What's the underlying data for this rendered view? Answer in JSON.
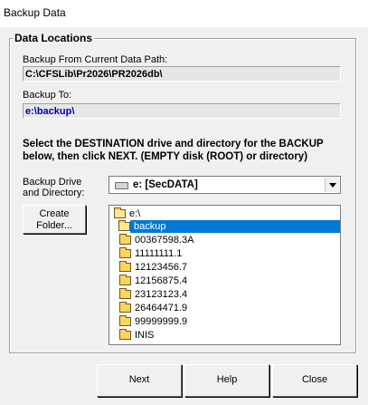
{
  "window": {
    "title": "Backup Data"
  },
  "group": {
    "title": "Data Locations"
  },
  "source": {
    "label": "Backup From Current Data Path:",
    "value": "C:\\CFSLib\\Pr2026\\PR2026db\\"
  },
  "dest": {
    "label": "Backup To:",
    "value": "e:\\backup\\"
  },
  "instructions": {
    "line1": "Select the DESTINATION drive and directory for the BACKUP",
    "line2": "below, then click NEXT. (EMPTY disk (ROOT) or directory)"
  },
  "drive": {
    "label_line1": "Backup Drive",
    "label_line2": "and Directory:",
    "selected": "e: [SecDATA]"
  },
  "create_folder": {
    "line1": "Create",
    "line2": "Folder..."
  },
  "directories": [
    {
      "name": "e:\\",
      "open": true,
      "selected": false
    },
    {
      "name": "backup",
      "open": true,
      "selected": true
    },
    {
      "name": "00367598.3A",
      "open": false,
      "selected": false
    },
    {
      "name": "11111111.1",
      "open": false,
      "selected": false
    },
    {
      "name": "12123456.7",
      "open": false,
      "selected": false
    },
    {
      "name": "12156875.4",
      "open": false,
      "selected": false
    },
    {
      "name": "23123123.4",
      "open": false,
      "selected": false
    },
    {
      "name": "26464471.9",
      "open": false,
      "selected": false
    },
    {
      "name": "99999999.9",
      "open": false,
      "selected": false
    },
    {
      "name": "INIS",
      "open": false,
      "selected": false
    }
  ],
  "buttons": {
    "next": "Next",
    "help": "Help",
    "close": "Close"
  }
}
